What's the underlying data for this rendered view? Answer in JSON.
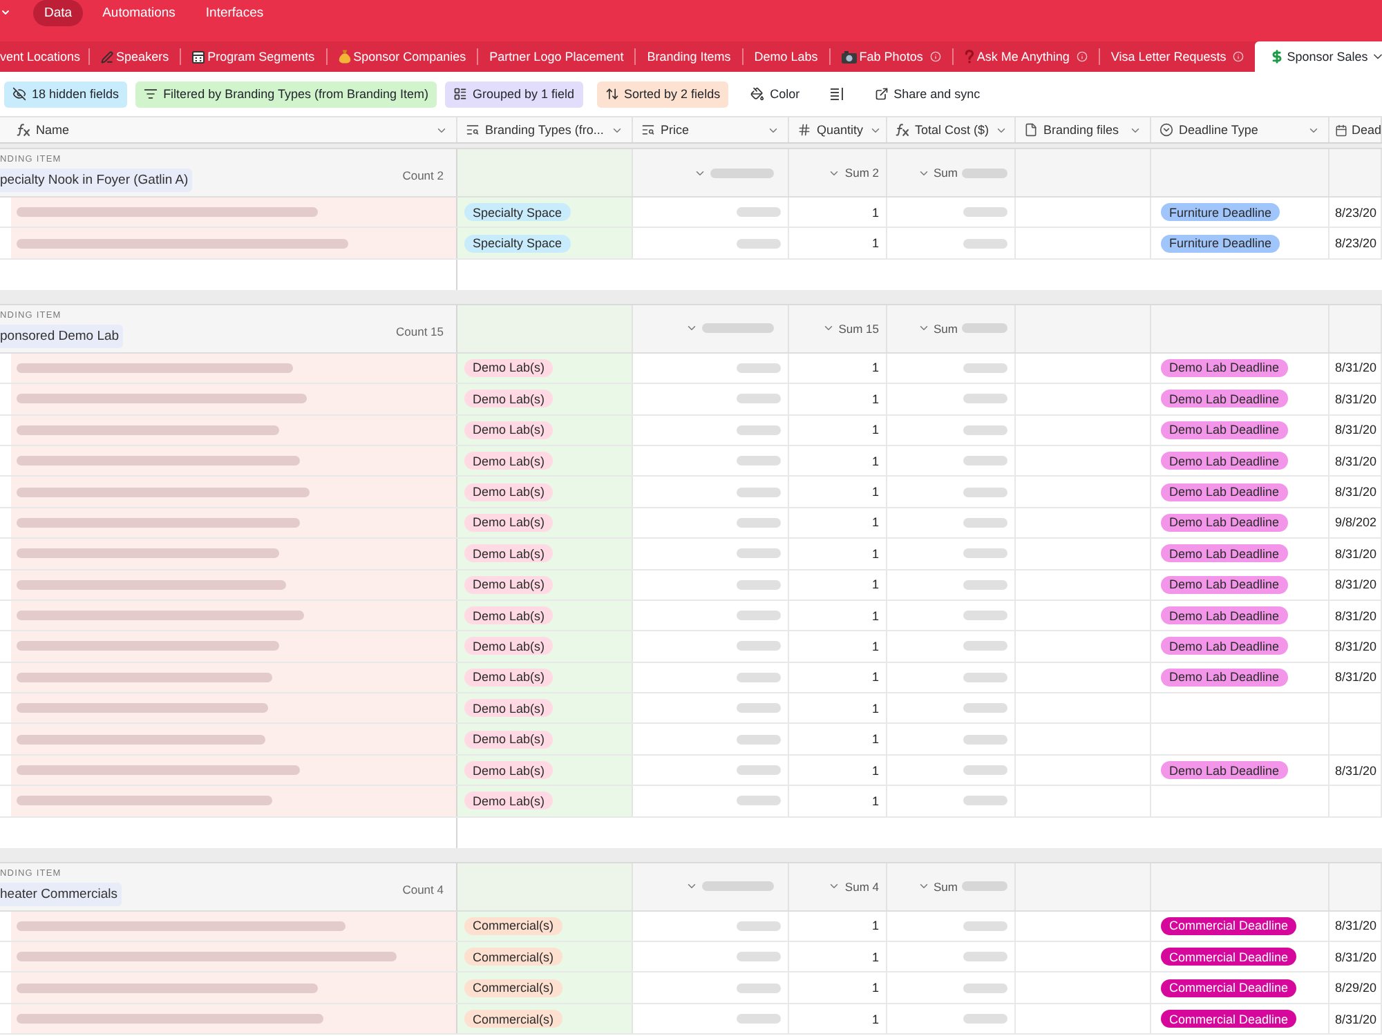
{
  "nav": {
    "items": [
      {
        "label": "Data",
        "selected": true
      },
      {
        "label": "Automations",
        "selected": false
      },
      {
        "label": "Interfaces",
        "selected": false
      }
    ]
  },
  "tabs": [
    {
      "label": "vent Locations",
      "selected": false,
      "info": false
    },
    {
      "label": "Speakers",
      "selected": false,
      "info": false
    },
    {
      "label": "Program Segments",
      "selected": false,
      "info": false
    },
    {
      "label": "Sponsor Companies",
      "selected": false,
      "info": false
    },
    {
      "label": "Partner Logo Placement",
      "selected": false,
      "info": false
    },
    {
      "label": "Branding Items",
      "selected": false,
      "info": false
    },
    {
      "label": "Demo Labs",
      "selected": false,
      "info": false
    },
    {
      "label": "Fab Photos",
      "selected": false,
      "info": true
    },
    {
      "label": "Ask Me Anything",
      "selected": false,
      "info": true
    },
    {
      "label": "Visa Letter Requests",
      "selected": false,
      "info": true
    },
    {
      "label": "Sponsor Sales",
      "selected": true,
      "info": false
    }
  ],
  "toolbar": [
    {
      "kind": "hidden",
      "label": "18 hidden fields",
      "color": "#c9ecfc"
    },
    {
      "kind": "filter",
      "label": "Filtered by Branding Types (from Branding Item)",
      "color": "#d2f4cc"
    },
    {
      "kind": "group",
      "label": "Grouped by 1 field",
      "color": "#e2ddfa"
    },
    {
      "kind": "sort",
      "label": "Sorted by 2 fields",
      "color": "#fde1d1"
    },
    {
      "kind": "color",
      "label": "Color"
    },
    {
      "kind": "row-height"
    },
    {
      "kind": "share",
      "label": "Share and sync"
    }
  ],
  "table": {
    "columns": [
      {
        "label": "Name",
        "kind": "formula"
      },
      {
        "label": "Branding Types (fro...",
        "kind": "lookup"
      },
      {
        "label": "Price",
        "kind": "lookup"
      },
      {
        "label": "Quantity",
        "kind": "number"
      },
      {
        "label": "Total Cost ($)",
        "kind": "formula"
      },
      {
        "label": "Branding files",
        "kind": "attachment"
      },
      {
        "label": "Deadline Type",
        "kind": "select"
      },
      {
        "label": "Dead",
        "kind": "date"
      }
    ],
    "groups": [
      {
        "field_label": "NDING ITEM",
        "title": "pecialty Nook in Foyer (Gatlin A)",
        "count": "Count 2",
        "quantity_sum": "Sum 2",
        "total_cost_sum": "Sum",
        "rows": [
          {
            "branding_type": {
              "label": "Specialty Space",
              "color": "#c9ecfc"
            },
            "quantity": "1",
            "deadline_type": {
              "label": "Furniture Deadline",
              "color": "#9fc5fb"
            },
            "deadline": "8/23/20"
          },
          {
            "branding_type": {
              "label": "Specialty Space",
              "color": "#c9ecfc"
            },
            "quantity": "1",
            "deadline_type": {
              "label": "Furniture Deadline",
              "color": "#9fc5fb"
            },
            "deadline": "8/23/20"
          }
        ]
      },
      {
        "field_label": "NDING ITEM",
        "title": "ponsored Demo Lab",
        "count": "Count 15",
        "quantity_sum": "Sum 15",
        "total_cost_sum": "Sum",
        "rows": [
          {
            "branding_type": {
              "label": "Demo Lab(s)",
              "color": "#ffd9e3"
            },
            "quantity": "1",
            "deadline_type": {
              "label": "Demo Lab Deadline",
              "color": "#f395e8"
            },
            "deadline": "8/31/20"
          },
          {
            "branding_type": {
              "label": "Demo Lab(s)",
              "color": "#ffd9e3"
            },
            "quantity": "1",
            "deadline_type": {
              "label": "Demo Lab Deadline",
              "color": "#f395e8"
            },
            "deadline": "8/31/20"
          },
          {
            "branding_type": {
              "label": "Demo Lab(s)",
              "color": "#ffd9e3"
            },
            "quantity": "1",
            "deadline_type": {
              "label": "Demo Lab Deadline",
              "color": "#f395e8"
            },
            "deadline": "8/31/20"
          },
          {
            "branding_type": {
              "label": "Demo Lab(s)",
              "color": "#ffd9e3"
            },
            "quantity": "1",
            "deadline_type": {
              "label": "Demo Lab Deadline",
              "color": "#f395e8"
            },
            "deadline": "8/31/20"
          },
          {
            "branding_type": {
              "label": "Demo Lab(s)",
              "color": "#ffd9e3"
            },
            "quantity": "1",
            "deadline_type": {
              "label": "Demo Lab Deadline",
              "color": "#f395e8"
            },
            "deadline": "8/31/20"
          },
          {
            "branding_type": {
              "label": "Demo Lab(s)",
              "color": "#ffd9e3"
            },
            "quantity": "1",
            "deadline_type": {
              "label": "Demo Lab Deadline",
              "color": "#f395e8"
            },
            "deadline": "9/8/202"
          },
          {
            "branding_type": {
              "label": "Demo Lab(s)",
              "color": "#ffd9e3"
            },
            "quantity": "1",
            "deadline_type": {
              "label": "Demo Lab Deadline",
              "color": "#f395e8"
            },
            "deadline": "8/31/20"
          },
          {
            "branding_type": {
              "label": "Demo Lab(s)",
              "color": "#ffd9e3"
            },
            "quantity": "1",
            "deadline_type": {
              "label": "Demo Lab Deadline",
              "color": "#f395e8"
            },
            "deadline": "8/31/20"
          },
          {
            "branding_type": {
              "label": "Demo Lab(s)",
              "color": "#ffd9e3"
            },
            "quantity": "1",
            "deadline_type": {
              "label": "Demo Lab Deadline",
              "color": "#f395e8"
            },
            "deadline": "8/31/20"
          },
          {
            "branding_type": {
              "label": "Demo Lab(s)",
              "color": "#ffd9e3"
            },
            "quantity": "1",
            "deadline_type": {
              "label": "Demo Lab Deadline",
              "color": "#f395e8"
            },
            "deadline": "8/31/20"
          },
          {
            "branding_type": {
              "label": "Demo Lab(s)",
              "color": "#ffd9e3"
            },
            "quantity": "1",
            "deadline_type": {
              "label": "Demo Lab Deadline",
              "color": "#f395e8"
            },
            "deadline": "8/31/20"
          },
          {
            "branding_type": {
              "label": "Demo Lab(s)",
              "color": "#ffd9e3"
            },
            "quantity": "1"
          },
          {
            "branding_type": {
              "label": "Demo Lab(s)",
              "color": "#ffd9e3"
            },
            "quantity": "1"
          },
          {
            "branding_type": {
              "label": "Demo Lab(s)",
              "color": "#ffd9e3"
            },
            "quantity": "1",
            "deadline_type": {
              "label": "Demo Lab Deadline",
              "color": "#f395e8"
            },
            "deadline": "8/31/20"
          },
          {
            "branding_type": {
              "label": "Demo Lab(s)",
              "color": "#ffd9e3"
            },
            "quantity": "1"
          }
        ]
      },
      {
        "field_label": "NDING ITEM",
        "title": "heater Commercials",
        "count": "Count 4",
        "quantity_sum": "Sum 4",
        "total_cost_sum": "Sum",
        "rows": [
          {
            "branding_type": {
              "label": "Commercial(s)",
              "color": "#fde0d0"
            },
            "quantity": "1",
            "deadline_type": {
              "label": "Commercial Deadline",
              "color": "#d6089c"
            },
            "deadline": "8/31/20"
          },
          {
            "branding_type": {
              "label": "Commercial(s)",
              "color": "#fde0d0"
            },
            "quantity": "1",
            "deadline_type": {
              "label": "Commercial Deadline",
              "color": "#d6089c"
            },
            "deadline": "8/31/20"
          },
          {
            "branding_type": {
              "label": "Commercial(s)",
              "color": "#fde0d0"
            },
            "quantity": "1",
            "deadline_type": {
              "label": "Commercial Deadline",
              "color": "#d6089c"
            },
            "deadline": "8/29/20"
          },
          {
            "branding_type": {
              "label": "Commercial(s)",
              "color": "#fde0d0"
            },
            "quantity": "1",
            "deadline_type": {
              "label": "Commercial Deadline",
              "color": "#d6089c"
            },
            "deadline": "8/31/20"
          }
        ]
      }
    ]
  }
}
